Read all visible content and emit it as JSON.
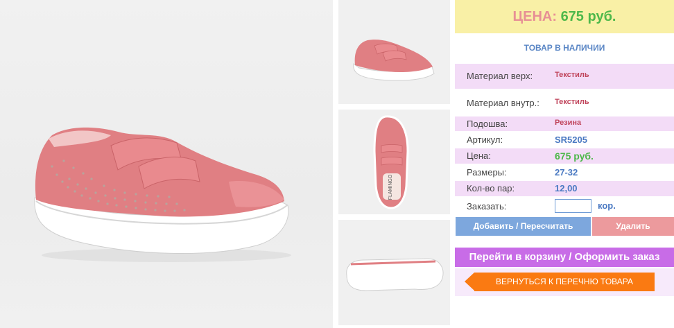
{
  "product": {
    "main_image_alt": "pink-sneaker-side-view",
    "thumbnails": [
      "sneaker-top-angle",
      "sneaker-top-down",
      "sneaker-sole"
    ],
    "sole_brand": "FLAMINGO"
  },
  "price_banner": {
    "label": "ЦЕНА:",
    "value": "675 руб."
  },
  "stock_status": "ТОВАР В НАЛИЧИИ",
  "specs": [
    {
      "label": "Материал верх:",
      "value": "Текстиль"
    },
    {
      "label": "Материал внутр.:",
      "value": "Текстиль"
    },
    {
      "label": "Подошва:",
      "value": "Резина"
    },
    {
      "label": "Артикул:",
      "value": "SR5205"
    },
    {
      "label": "Цена:",
      "value": "675 руб."
    },
    {
      "label": "Размеры:",
      "value": "27-32"
    },
    {
      "label": "Кол-во пар:",
      "value": "12,00"
    }
  ],
  "order": {
    "label": "Заказать:",
    "input_value": "",
    "unit": "кор."
  },
  "buttons": {
    "add": "Добавить / Пересчитать",
    "delete": "Удалить",
    "cart": "Перейти в корзину / Оформить заказ",
    "back": "ВЕРНУТЬСЯ К ПЕРЕЧНЮ ТОВАРА"
  },
  "colors": {
    "price_label": "#e78f95",
    "price_value": "#4db84a",
    "banner_bg": "#f9f0a6",
    "lavender": "#f3dcf7",
    "blue_button": "#7da7dd",
    "pink_button": "#ec9a9d",
    "purple_button": "#c86ce7",
    "orange_button": "#fa7a12",
    "shoe_pink": "#e07f83"
  }
}
